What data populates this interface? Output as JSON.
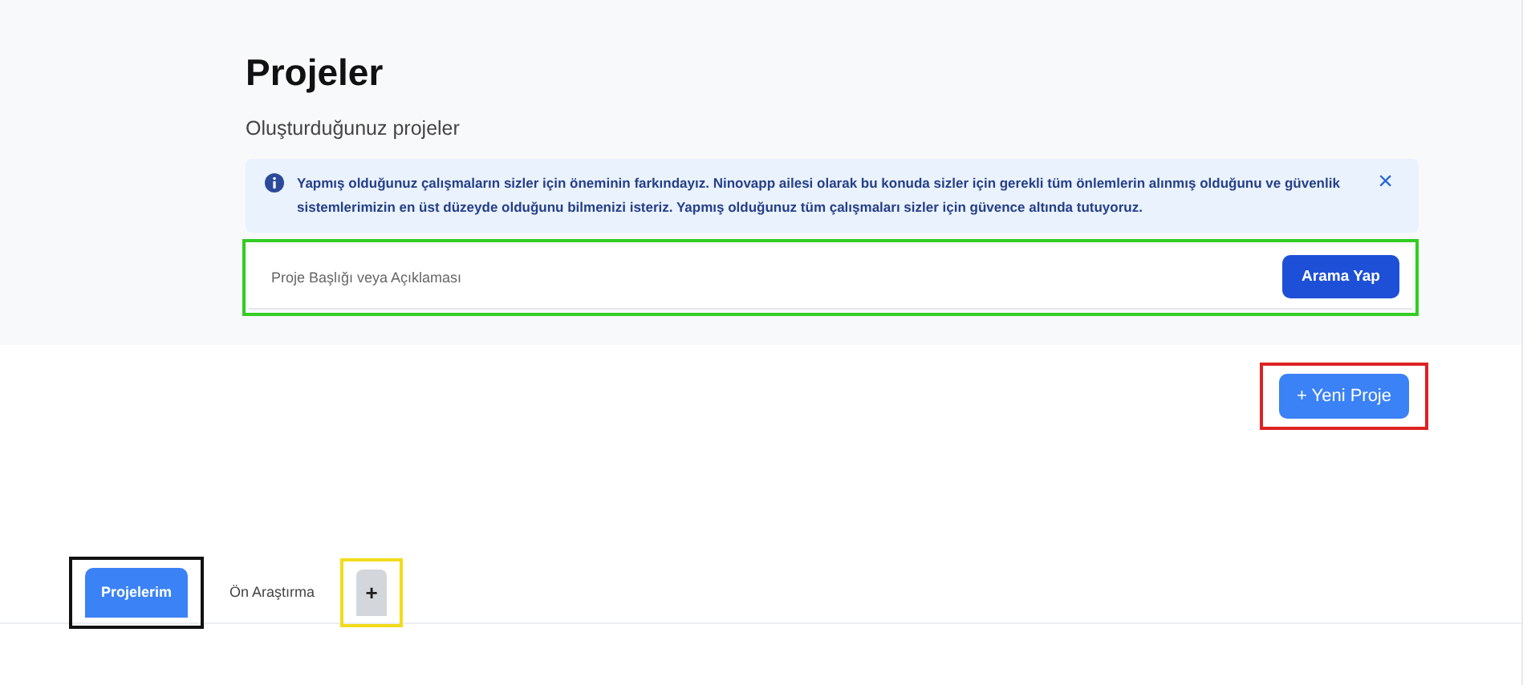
{
  "header": {
    "title": "Projeler",
    "subtitle": "Oluşturduğunuz projeler"
  },
  "alert": {
    "text": "Yapmış olduğunuz çalışmaların sizler için öneminin farkındayız. Ninovapp ailesi olarak bu konuda sizler için gerekli tüm önlemlerin alınmış olduğunu ve güvenlik sistemlerimizin en üst düzeyde olduğunu bilmenizi isteriz. Yapmış olduğunuz tüm çalışmaları sizler için güvence altında tutuyoruz.",
    "close": "×"
  },
  "search": {
    "placeholder": "Proje Başlığı veya Açıklaması",
    "button": "Arama Yap",
    "color": "#33cc22"
  },
  "new_project": {
    "label": "+ Yeni Proje",
    "color": "#dd2222"
  },
  "tabs": [
    {
      "kind": "tab",
      "label": "Projelerim",
      "selected": true,
      "color": "#111111"
    },
    {
      "kind": "tab",
      "label": "Ön Araştırma",
      "selected": false
    },
    {
      "kind": "add",
      "label": "+",
      "selected": false,
      "color": "#f2dc1a"
    }
  ]
}
